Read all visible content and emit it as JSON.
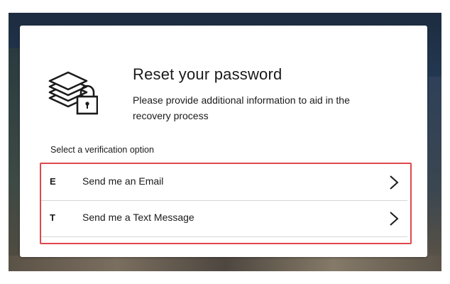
{
  "header": {
    "title": "Reset your password",
    "subtitle": "Please provide additional information to aid in the recovery process",
    "logo_icon": "layers-lock-icon"
  },
  "verification": {
    "section_label": "Select a verification option",
    "options": [
      {
        "letter": "E",
        "label": "Send me an Email",
        "icon": "chevron-right-icon"
      },
      {
        "letter": "T",
        "label": "Send me a Text Message",
        "icon": "chevron-right-icon"
      }
    ],
    "highlight_color": "#e0474c"
  }
}
